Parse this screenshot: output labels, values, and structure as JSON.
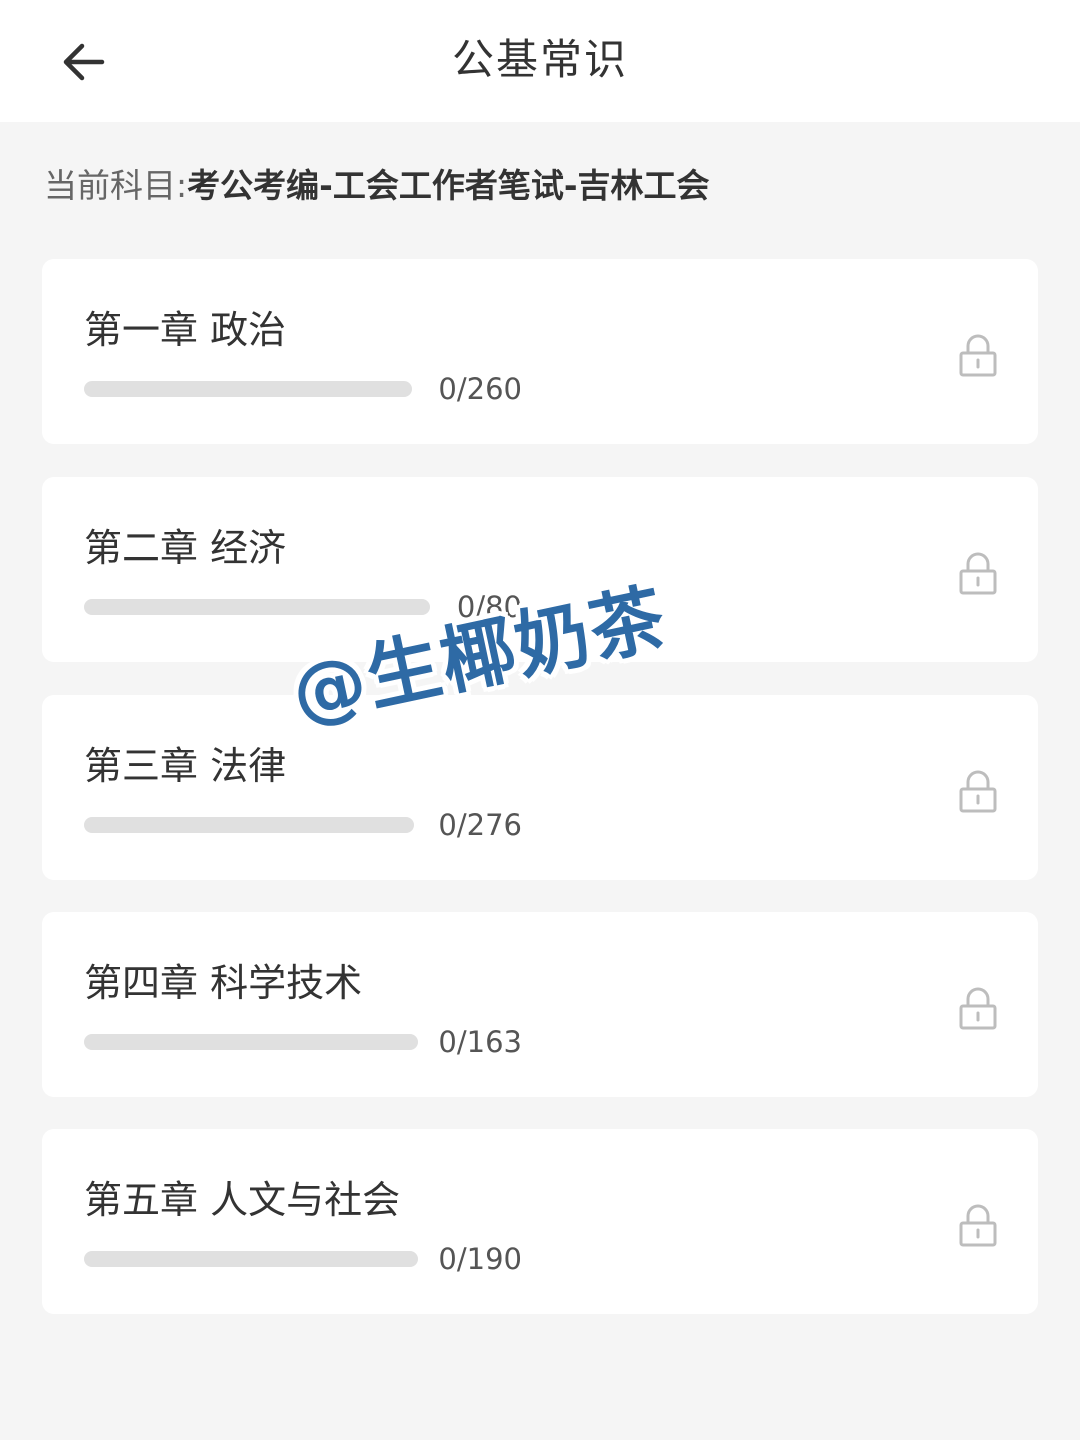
{
  "header": {
    "title": "公基常识",
    "back_icon": "arrow-left-icon"
  },
  "subject": {
    "label": "当前科目:",
    "value": "考公考编-工会工作者笔试-吉林工会"
  },
  "chapters": [
    {
      "title": "第一章 政治",
      "done": 0,
      "total": 260,
      "count_text": "0/260",
      "locked": true
    },
    {
      "title": "第二章 经济",
      "done": 0,
      "total": 80,
      "count_text": "0/80",
      "locked": true
    },
    {
      "title": "第三章 法律",
      "done": 0,
      "total": 276,
      "count_text": "0/276",
      "locked": true
    },
    {
      "title": "第四章 科学技术",
      "done": 0,
      "total": 163,
      "count_text": "0/163",
      "locked": true
    },
    {
      "title": "第五章 人文与社会",
      "done": 0,
      "total": 190,
      "count_text": "0/190",
      "locked": true
    }
  ],
  "watermark": "@生椰奶茶",
  "colors": {
    "accent": "#4a90e2",
    "watermark": "#2e6aa5",
    "track": "#e0e0e0"
  }
}
